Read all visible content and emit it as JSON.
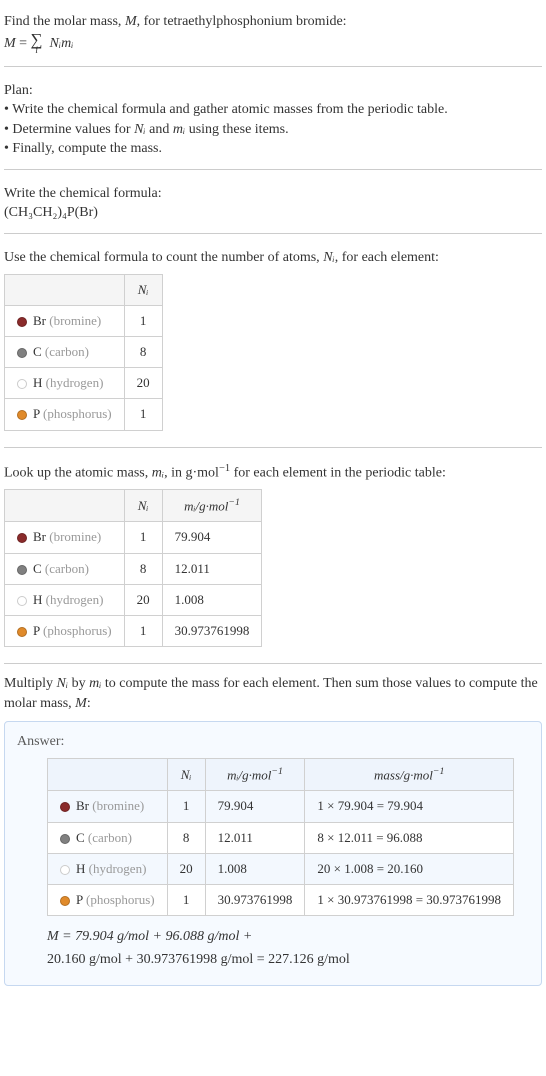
{
  "intro": {
    "line1_pre": "Find the molar mass, ",
    "line1_var": "M",
    "line1_post": ", for tetraethylphosphonium bromide:",
    "eq_lhs": "M",
    "eq_eq": " = ",
    "eq_sum_sub": "i",
    "eq_terms": "Nᵢmᵢ"
  },
  "plan": {
    "title": "Plan:",
    "b1": "• Write the chemical formula and gather atomic masses from the periodic table.",
    "b2_pre": "• Determine values for ",
    "b2_n": "Nᵢ",
    "b2_and": " and ",
    "b2_m": "mᵢ",
    "b2_post": " using these items.",
    "b3": "• Finally, compute the mass."
  },
  "chem": {
    "title": "Write the chemical formula:",
    "formula": "(CH₃CH₂)₄P(Br)"
  },
  "count": {
    "line_pre": "Use the chemical formula to count the number of atoms, ",
    "line_var": "Nᵢ",
    "line_post": ", for each element:",
    "h_n": "Nᵢ",
    "rows": [
      {
        "color": "#8a2b2b",
        "el": "Br",
        "name": "(bromine)",
        "n": "1"
      },
      {
        "color": "#808080",
        "el": "C",
        "name": "(carbon)",
        "n": "8"
      },
      {
        "color": "#ffffff",
        "el": "H",
        "name": "(hydrogen)",
        "n": "20"
      },
      {
        "color": "#e08a2a",
        "el": "P",
        "name": "(phosphorus)",
        "n": "1"
      }
    ]
  },
  "lookup": {
    "line_pre": "Look up the atomic mass, ",
    "line_var": "mᵢ",
    "line_mid": ", in g·mol",
    "line_exp": "−1",
    "line_post": " for each element in the periodic table:",
    "h_n": "Nᵢ",
    "h_m_pre": "mᵢ/g·mol",
    "h_m_exp": "−1",
    "rows": [
      {
        "color": "#8a2b2b",
        "el": "Br",
        "name": "(bromine)",
        "n": "1",
        "m": "79.904"
      },
      {
        "color": "#808080",
        "el": "C",
        "name": "(carbon)",
        "n": "8",
        "m": "12.011"
      },
      {
        "color": "#ffffff",
        "el": "H",
        "name": "(hydrogen)",
        "n": "20",
        "m": "1.008"
      },
      {
        "color": "#e08a2a",
        "el": "P",
        "name": "(phosphorus)",
        "n": "1",
        "m": "30.973761998"
      }
    ]
  },
  "multiply": {
    "line_pre": "Multiply ",
    "n": "Nᵢ",
    "by": " by ",
    "m": "mᵢ",
    "mid": " to compute the mass for each element. Then sum those values to compute the molar mass, ",
    "mvar": "M",
    "post": ":"
  },
  "answer": {
    "label": "Answer:",
    "h_n": "Nᵢ",
    "h_m_pre": "mᵢ/g·mol",
    "h_m_exp": "−1",
    "h_mass_pre": "mass/g·mol",
    "h_mass_exp": "−1",
    "rows": [
      {
        "color": "#8a2b2b",
        "el": "Br",
        "name": "(bromine)",
        "n": "1",
        "m": "79.904",
        "mass": "1 × 79.904 = 79.904"
      },
      {
        "color": "#808080",
        "el": "C",
        "name": "(carbon)",
        "n": "8",
        "m": "12.011",
        "mass": "8 × 12.011 = 96.088"
      },
      {
        "color": "#ffffff",
        "el": "H",
        "name": "(hydrogen)",
        "n": "20",
        "m": "1.008",
        "mass": "20 × 1.008 = 20.160"
      },
      {
        "color": "#e08a2a",
        "el": "P",
        "name": "(phosphorus)",
        "n": "1",
        "m": "30.973761998",
        "mass": "1 × 30.973761998 = 30.973761998"
      }
    ],
    "final1": "M = 79.904 g/mol + 96.088 g/mol + ",
    "final2": "20.160 g/mol + 30.973761998 g/mol = 227.126 g/mol"
  }
}
